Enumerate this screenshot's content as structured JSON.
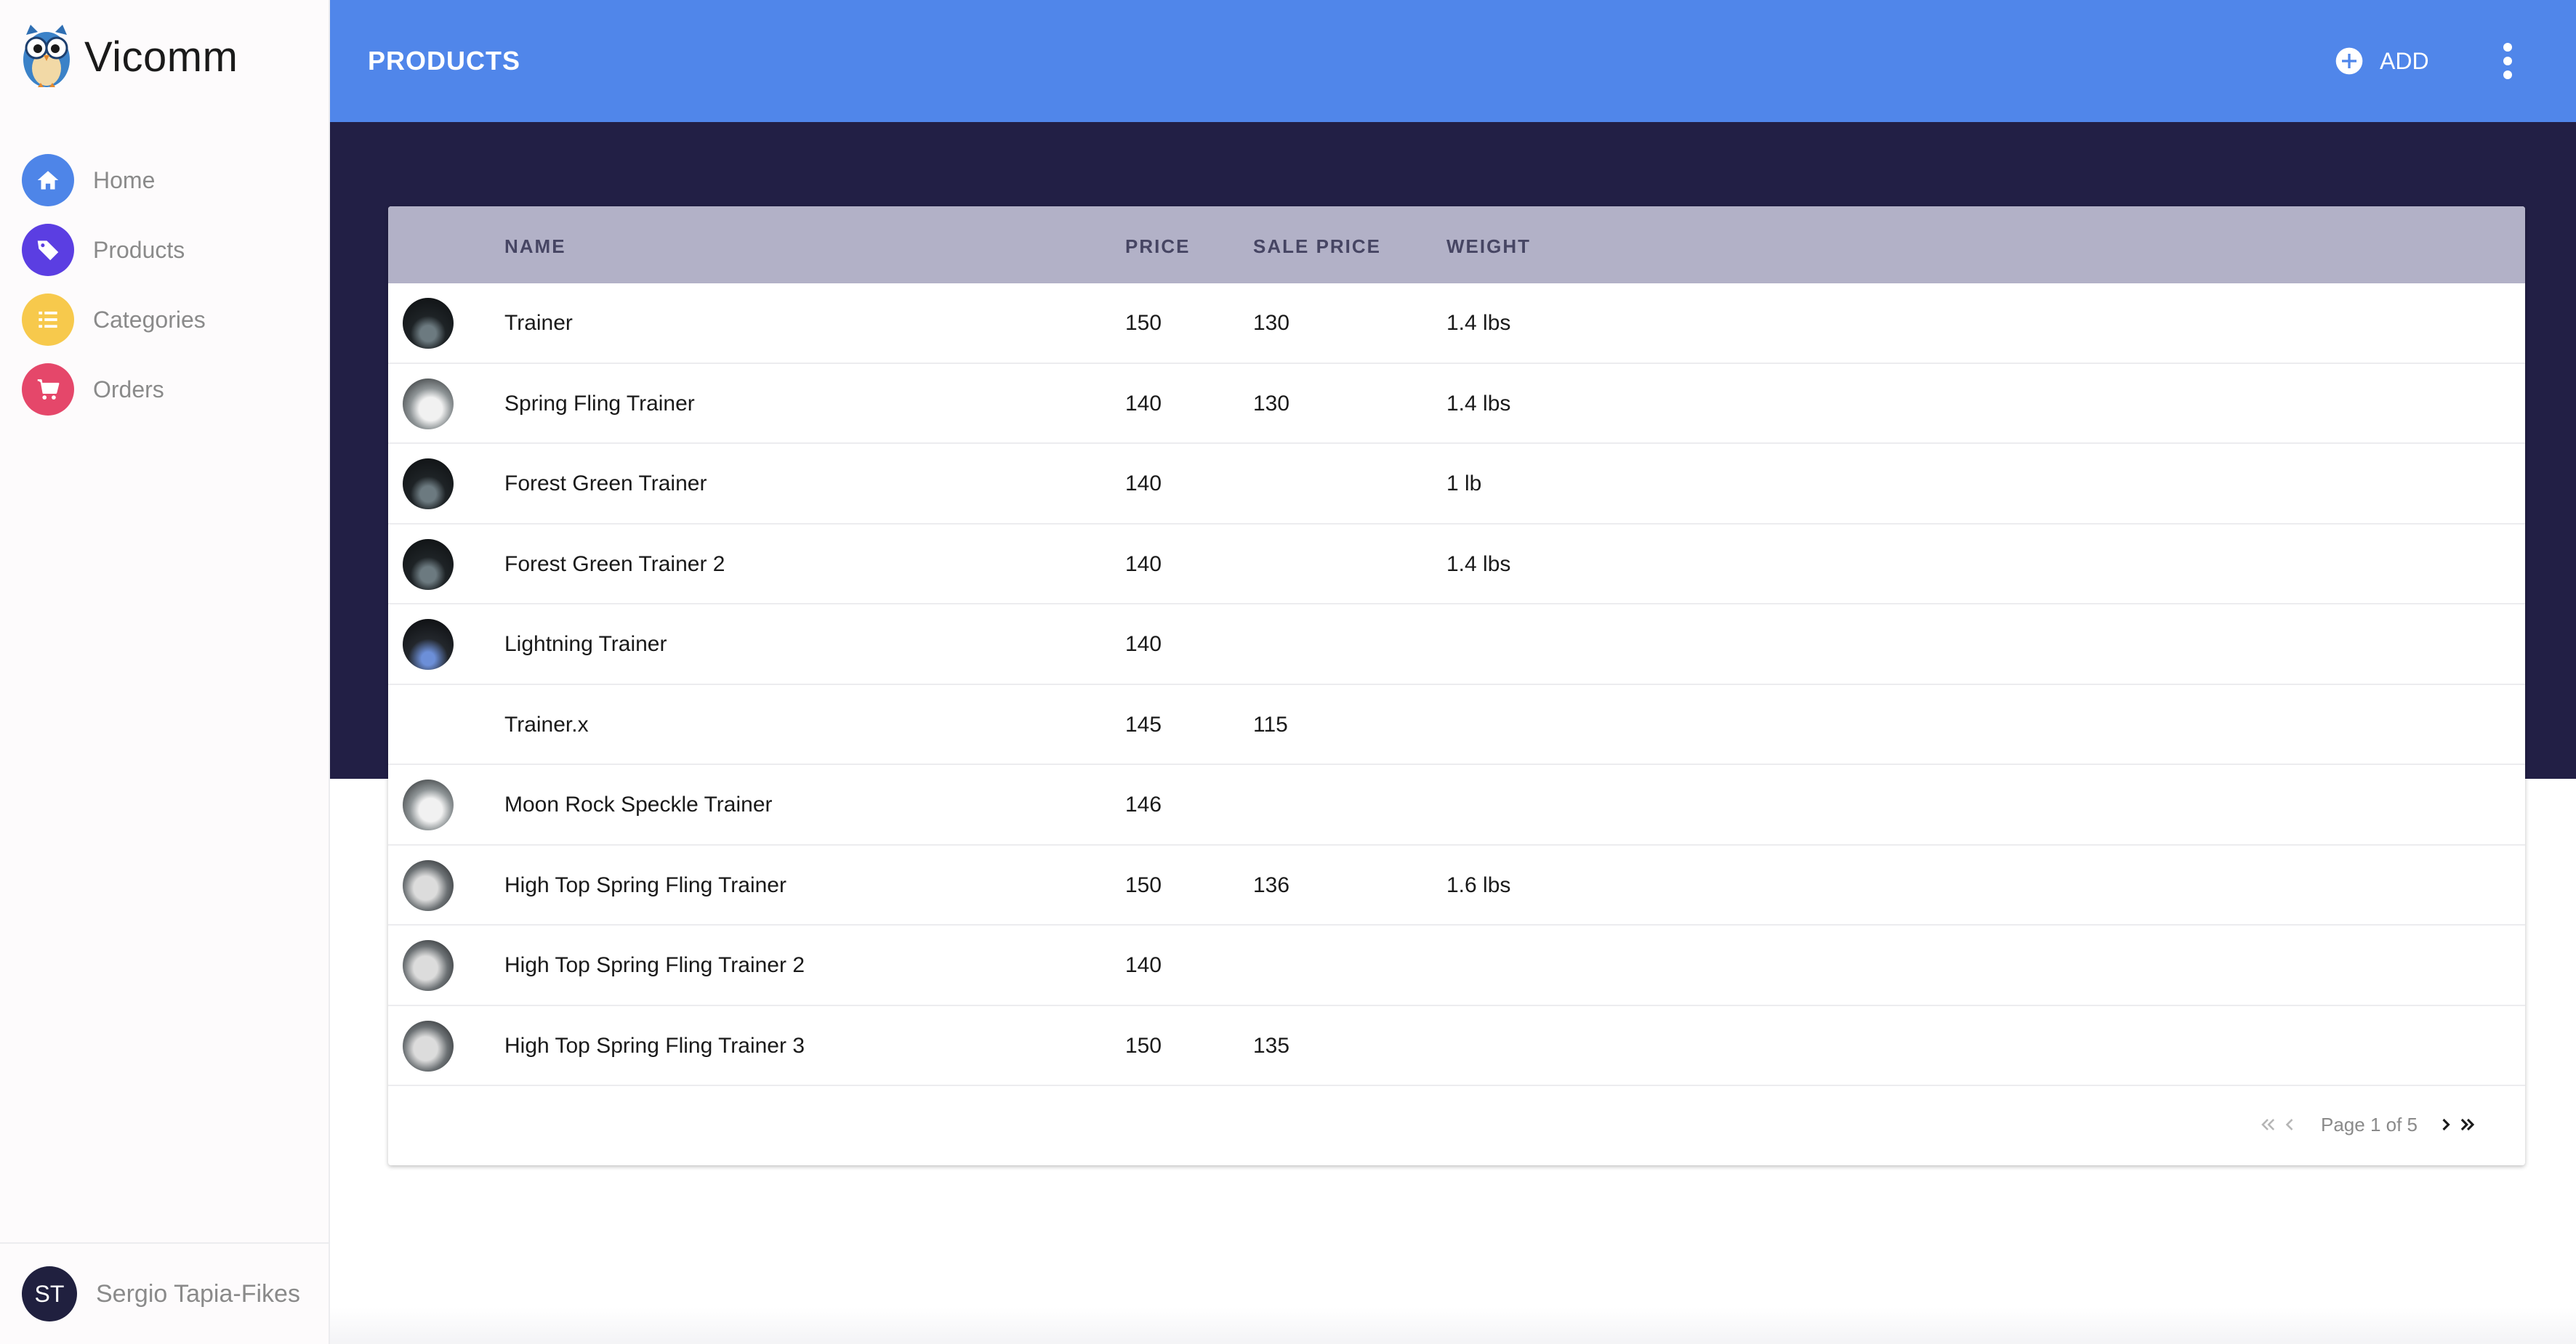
{
  "brand": {
    "name": "Vicomm"
  },
  "nav": [
    {
      "label": "Home",
      "icon": "home-icon",
      "color": "#4e85e8"
    },
    {
      "label": "Products",
      "icon": "tag-icon",
      "color": "#5b3ee2"
    },
    {
      "label": "Categories",
      "icon": "list-icon",
      "color": "#f7c94c"
    },
    {
      "label": "Orders",
      "icon": "cart-icon",
      "color": "#e5476a"
    }
  ],
  "user": {
    "initials": "ST",
    "name": "Sergio Tapia-Fikes"
  },
  "header": {
    "title": "PRODUCTS",
    "add_label": "ADD",
    "accent": "#5086ea",
    "band": "#221f45"
  },
  "table": {
    "columns": {
      "name": "NAME",
      "price": "PRICE",
      "sale_price": "SALE PRICE",
      "weight": "WEIGHT"
    },
    "rows": [
      {
        "name": "Trainer",
        "price": "150",
        "sale_price": "130",
        "weight": "1.4 lbs",
        "thumb": "dark"
      },
      {
        "name": "Spring Fling Trainer",
        "price": "140",
        "sale_price": "130",
        "weight": "1.4 lbs",
        "thumb": "light"
      },
      {
        "name": "Forest Green Trainer",
        "price": "140",
        "sale_price": "",
        "weight": "1 lb",
        "thumb": "dark"
      },
      {
        "name": "Forest Green Trainer 2",
        "price": "140",
        "sale_price": "",
        "weight": "1.4 lbs",
        "thumb": "dark"
      },
      {
        "name": "Lightning Trainer",
        "price": "140",
        "sale_price": "",
        "weight": "",
        "thumb": "blue"
      },
      {
        "name": "Trainer.x",
        "price": "145",
        "sale_price": "115",
        "weight": "",
        "thumb": "none"
      },
      {
        "name": "Moon Rock Speckle Trainer",
        "price": "146",
        "sale_price": "",
        "weight": "",
        "thumb": "light"
      },
      {
        "name": "High Top Spring Fling Trainer",
        "price": "150",
        "sale_price": "136",
        "weight": "1.6 lbs",
        "thumb": "hightop"
      },
      {
        "name": "High Top Spring Fling Trainer 2",
        "price": "140",
        "sale_price": "",
        "weight": "",
        "thumb": "hightop"
      },
      {
        "name": "High Top Spring Fling Trainer 3",
        "price": "150",
        "sale_price": "135",
        "weight": "",
        "thumb": "hightop"
      }
    ]
  },
  "pagination": {
    "label": "Page 1 of 5"
  }
}
